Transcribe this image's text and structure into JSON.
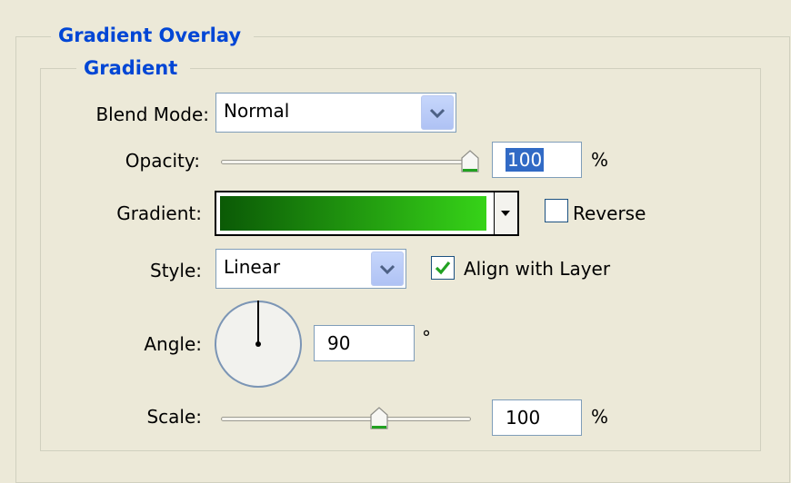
{
  "section_title": "Gradient Overlay",
  "group_title": "Gradient",
  "blend_mode": {
    "label": "Blend Mode:",
    "value": "Normal"
  },
  "opacity": {
    "label": "Opacity:",
    "value": "100",
    "unit": "%",
    "slider_fraction": 1.0
  },
  "gradient": {
    "label": "Gradient:",
    "start_color": "#0B5A06",
    "end_color": "#36D318",
    "reverse_label": "Reverse",
    "reverse_checked": false
  },
  "style": {
    "label": "Style:",
    "value": "Linear",
    "align_label": "Align with Layer",
    "align_checked": true
  },
  "angle": {
    "label": "Angle:",
    "value": "90",
    "unit": "°"
  },
  "scale": {
    "label": "Scale:",
    "value": "100",
    "unit": "%",
    "slider_fraction": 0.6
  },
  "icons": {
    "dropdown": "chevron-down-icon",
    "checkmark": "check-icon",
    "slider_thumb": "slider-thumb-icon"
  }
}
